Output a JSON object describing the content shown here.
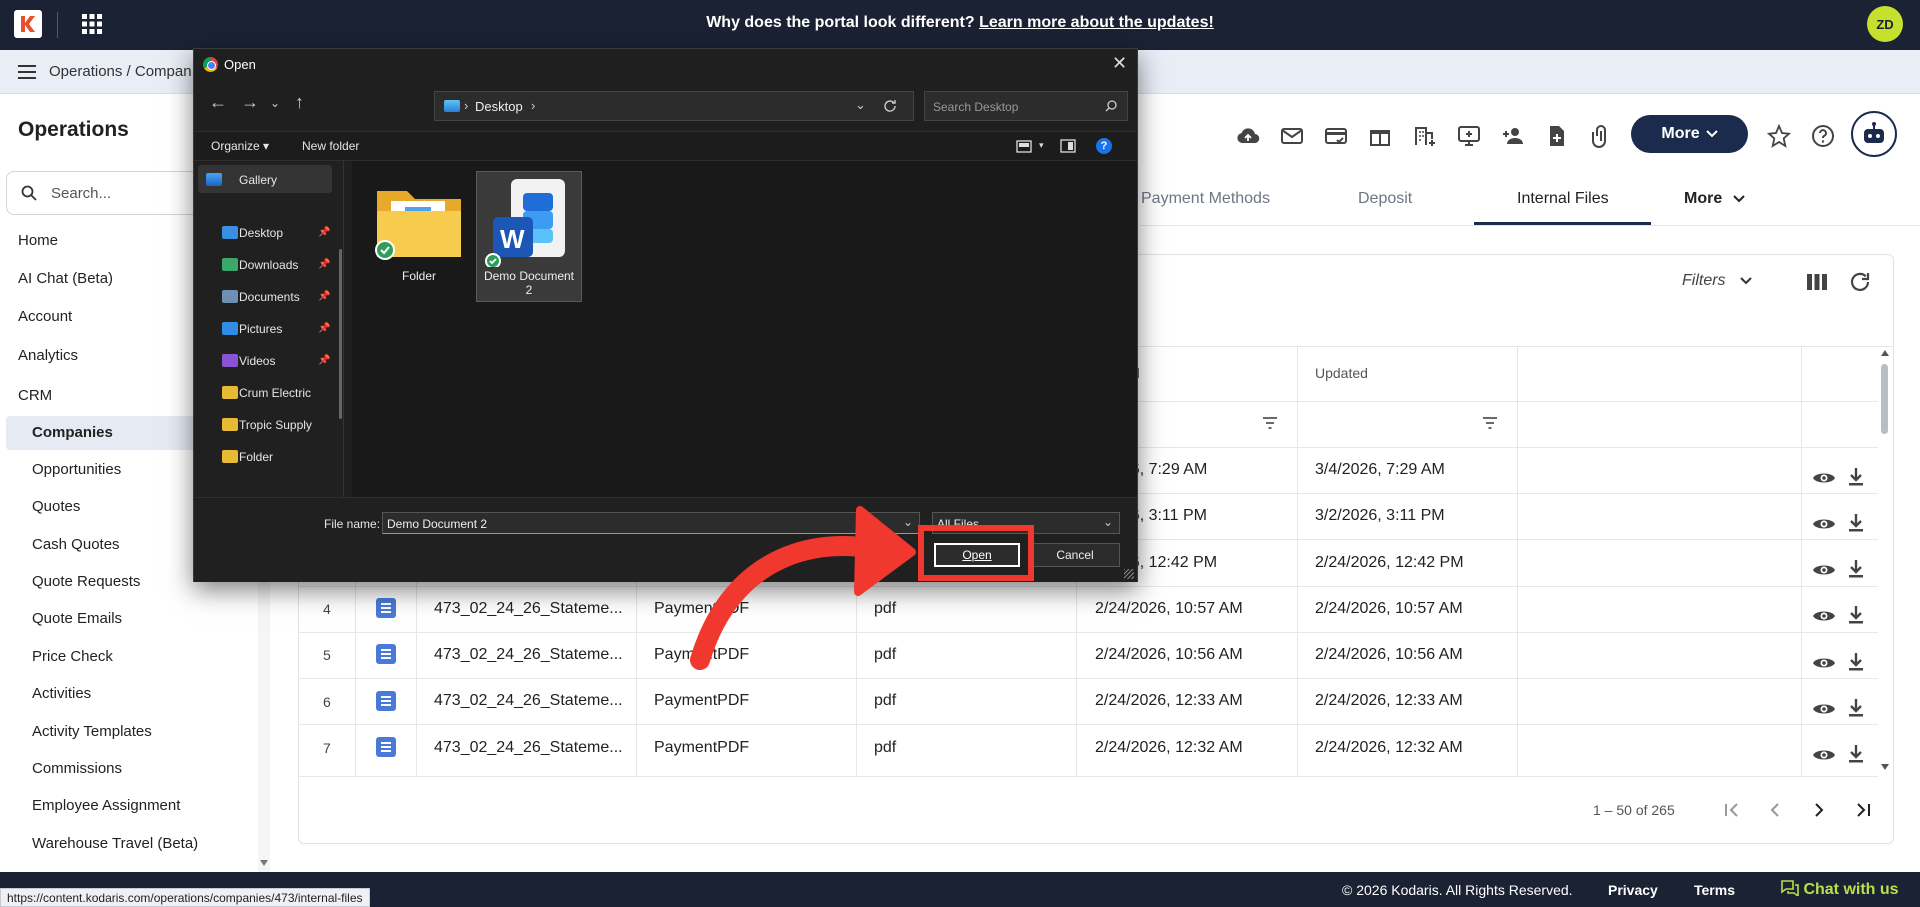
{
  "topbar": {
    "banner_prefix": "Why does the portal look different?",
    "banner_link": "Learn more about the updates!",
    "avatar_initials": "ZD"
  },
  "breadcrumb": {
    "text": "Operations / Compan"
  },
  "sidebar": {
    "title": "Operations",
    "search_placeholder": "Search...",
    "items": [
      "Home",
      "AI Chat (Beta)",
      "Account",
      "Analytics",
      "CRM"
    ],
    "subitems": [
      "Companies",
      "Opportunities",
      "Quotes",
      "Cash Quotes",
      "Quote Requests",
      "Quote Emails",
      "Price Check",
      "Activities",
      "Activity Templates",
      "Commissions",
      "Employee Assignment",
      "Warehouse Travel (Beta)"
    ],
    "active": "Companies"
  },
  "toolbar": {
    "more_label": "More",
    "icons": [
      "cloud-upload-icon",
      "mail-icon",
      "card-check-icon",
      "gift-icon",
      "building-add-icon",
      "monitor-add-icon",
      "user-add-icon",
      "file-add-icon",
      "paperclip-icon"
    ]
  },
  "tabs": {
    "items": [
      "Payment Methods",
      "Deposit",
      "Internal Files"
    ],
    "active": "Internal Files",
    "more_label": "More"
  },
  "table": {
    "filters_label": "Filters",
    "headers": [
      "d",
      "Updated"
    ],
    "rows": [
      {
        "num": "",
        "name": "",
        "type": "",
        "ext": "",
        "created": "026, 7:29 AM",
        "updated": "3/4/2026, 7:29 AM"
      },
      {
        "num": "",
        "name": "",
        "type": "",
        "ext": "",
        "created": "026, 3:11 PM",
        "updated": "3/2/2026, 3:11 PM"
      },
      {
        "num": "",
        "name": "",
        "type": "",
        "ext": "",
        "created": "026, 12:42 PM",
        "updated": "2/24/2026, 12:42 PM"
      },
      {
        "num": "4",
        "name": "473_02_24_26_Stateme...",
        "type": "PaymentPDF",
        "ext": "pdf",
        "created": "2/24/2026, 10:57 AM",
        "updated": "2/24/2026, 10:57 AM"
      },
      {
        "num": "5",
        "name": "473_02_24_26_Stateme...",
        "type": "PaymentPDF",
        "ext": "pdf",
        "created": "2/24/2026, 10:56 AM",
        "updated": "2/24/2026, 10:56 AM"
      },
      {
        "num": "6",
        "name": "473_02_24_26_Stateme...",
        "type": "PaymentPDF",
        "ext": "pdf",
        "created": "2/24/2026, 12:33 AM",
        "updated": "2/24/2026, 12:33 AM"
      },
      {
        "num": "7",
        "name": "473_02_24_26_Stateme...",
        "type": "PaymentPDF",
        "ext": "pdf",
        "created": "2/24/2026, 12:32 AM",
        "updated": "2/24/2026, 12:32 AM"
      }
    ],
    "pager_text": "1 – 50 of 265"
  },
  "footer": {
    "copyright": "© 2026 Kodaris. All Rights Reserved.",
    "privacy": "Privacy",
    "terms": "Terms",
    "chat": "Chat with us",
    "status_url": "https://content.kodaris.com/operations/companies/473/internal-files"
  },
  "dialog": {
    "title": "Open",
    "location": "Desktop",
    "search_placeholder": "Search Desktop",
    "organize": "Organize",
    "new_folder": "New folder",
    "nav": {
      "gallery": "Gallery",
      "quick": [
        "Desktop",
        "Downloads",
        "Documents",
        "Pictures",
        "Videos"
      ],
      "folders": [
        "Crum Electric",
        "Tropic Supply",
        "Folder"
      ]
    },
    "files": [
      "Folder",
      "Demo Document 2"
    ],
    "file_name_label": "File name:",
    "file_name_value": "Demo Document 2",
    "file_type": "All Files",
    "open_label": "Open",
    "cancel_label": "Cancel"
  },
  "colors": {
    "navy": "#1b2233",
    "brand_button": "#1b2b4e",
    "accent_green": "#c6e02e",
    "annotation_red": "#f1382e",
    "doc_blue": "#4a7ad8"
  }
}
